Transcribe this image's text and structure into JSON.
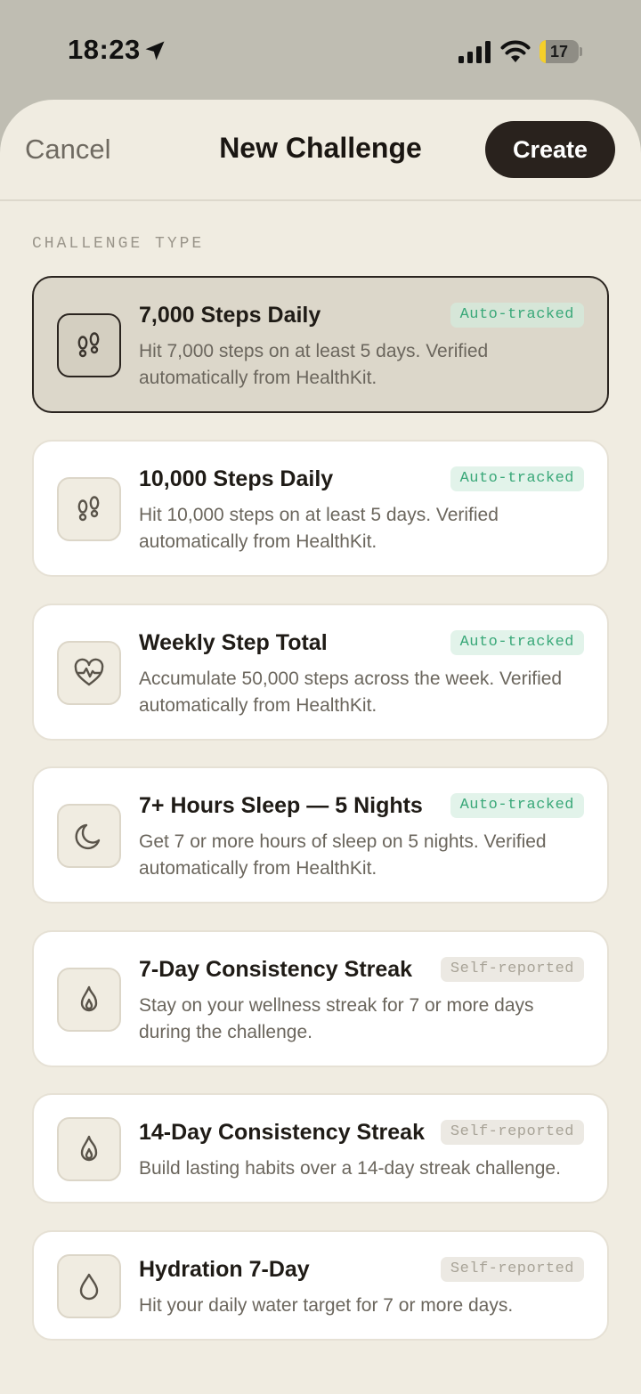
{
  "status_bar": {
    "time": "18:23",
    "battery_level": "17",
    "battery_fraction": 0.17,
    "icons": [
      "location-arrow-icon",
      "cellular-signal-icon",
      "wifi-icon",
      "battery-icon"
    ]
  },
  "nav": {
    "cancel_label": "Cancel",
    "title": "New Challenge",
    "create_label": "Create"
  },
  "section": {
    "label": "CHALLENGE TYPE"
  },
  "colors": {
    "accent_dark": "#29221d",
    "sheet_bg": "#f0ece1",
    "auto_badge_text": "#3aa879",
    "auto_badge_bg": "#e2f3ea",
    "self_badge_text": "#a8a397",
    "battery_low": "#f5d02a"
  },
  "challenges": [
    {
      "title": "7,000 Steps Daily",
      "badge": "Auto-tracked",
      "badge_type": "auto",
      "description": "Hit 7,000 steps on at least 5 days. Verified automatically from HealthKit.",
      "icon": "footprints-icon",
      "selected": true
    },
    {
      "title": "10,000 Steps Daily",
      "badge": "Auto-tracked",
      "badge_type": "auto",
      "description": "Hit 10,000 steps on at least 5 days. Verified automatically from HealthKit.",
      "icon": "footprints-icon",
      "selected": false
    },
    {
      "title": "Weekly Step Total",
      "badge": "Auto-tracked",
      "badge_type": "auto",
      "description": "Accumulate 50,000 steps across the week. Verified automatically from HealthKit.",
      "icon": "heart-pulse-icon",
      "selected": false
    },
    {
      "title": "7+ Hours Sleep — 5 Nights",
      "badge": "Auto-tracked",
      "badge_type": "auto",
      "description": "Get 7 or more hours of sleep on 5 nights. Verified automatically from HealthKit.",
      "icon": "moon-icon",
      "selected": false
    },
    {
      "title": "7-Day Consistency Streak",
      "badge": "Self-reported",
      "badge_type": "self",
      "description": "Stay on your wellness streak for 7 or more days during the challenge.",
      "icon": "flame-icon",
      "selected": false
    },
    {
      "title": "14-Day Consistency Streak",
      "badge": "Self-reported",
      "badge_type": "self",
      "description": "Build lasting habits over a 14-day streak challenge.",
      "icon": "flame-icon",
      "selected": false
    },
    {
      "title": "Hydration 7-Day",
      "badge": "Self-reported",
      "badge_type": "self",
      "description": "Hit your daily water target for 7 or more days.",
      "icon": "water-drop-icon",
      "selected": false
    }
  ]
}
